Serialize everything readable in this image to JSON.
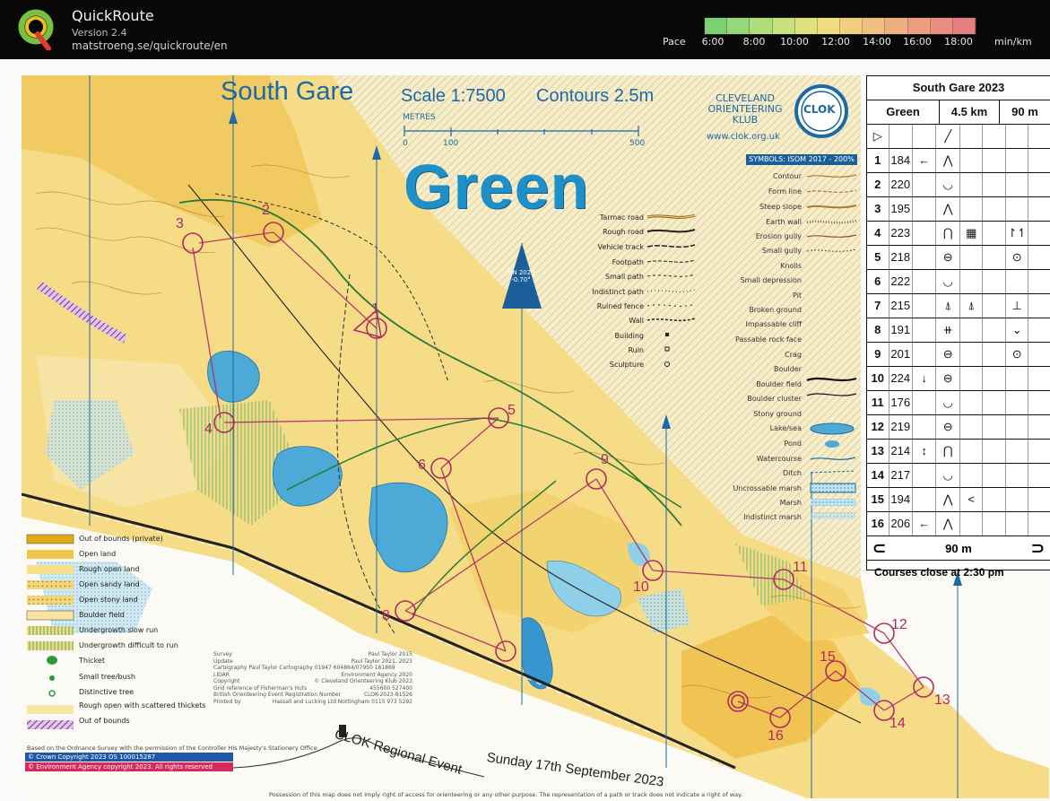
{
  "app": {
    "title": "QuickRoute",
    "version": "Version 2.4",
    "url": "matstroeng.se/quickroute/en"
  },
  "pace": {
    "label": "Pace",
    "ticks": [
      "6:00",
      "8:00",
      "10:00",
      "12:00",
      "14:00",
      "16:00",
      "18:00"
    ],
    "unit": "min/km",
    "colors": [
      "#7bd076",
      "#95d77a",
      "#b0dc7c",
      "#c8e07e",
      "#dfe27f",
      "#eddc80",
      "#f2cf80",
      "#f1bf80",
      "#efaf80",
      "#ec9e80",
      "#e98e80",
      "#e67f80"
    ]
  },
  "map": {
    "title": "South Gare",
    "scale": "Scale 1:7500",
    "contours": "Contours 2.5m",
    "scalebar_unit": "METRES",
    "scalebar_ticks": [
      "0",
      "100",
      "500"
    ],
    "course": "Green",
    "club_name": "CLEVELAND ORIENTEERING KLUB",
    "club_url": "www.clok.org.uk",
    "club_logo_text": "CLOK",
    "symbols_badge": "SYMBOLS: ISOM 2017 - 200%",
    "magnetic_north": "MN 2023 -0.70°",
    "event_title": "CLOK Regional Event",
    "event_date": "Sunday 17th September 2023",
    "controls": [
      "1",
      "2",
      "3",
      "4",
      "5",
      "6",
      "8",
      "9",
      "10",
      "11",
      "12",
      "13",
      "14",
      "15",
      "16"
    ]
  },
  "legend_right": [
    "Contour",
    "Form line",
    "Steep slope",
    "Earth wall",
    "Erosion gully",
    "Small gully",
    "Knolls",
    "Small depression",
    "Pit",
    "Broken ground",
    "Impassable cliff",
    "Passable rock face",
    "Crag",
    "Boulder",
    "Boulder field",
    "Boulder cluster",
    "Stony ground",
    "Lake/sea",
    "Pond",
    "Watercourse",
    "Ditch",
    "Uncrossable marsh",
    "Marsh",
    "Indistinct marsh"
  ],
  "legend_mid": [
    "Tarmac road",
    "Rough road",
    "Vehicle track",
    "Footpath",
    "Small path",
    "Indistinct path",
    "Ruined fence",
    "Wall",
    "Building",
    "Ruin",
    "Sculpture"
  ],
  "legend_left": [
    "Out of bounds (private)",
    "Open land",
    "Rough open land",
    "Open sandy land",
    "Open stony land",
    "Boulder field",
    "Undergrowth slow run",
    "Undergrowth difficult to run",
    "Thicket",
    "Small tree/bush",
    "Distinctive tree",
    "Rough open with scattered thickets",
    "Out of bounds"
  ],
  "credits": [
    [
      "Survey",
      "Paul Taylor 2015"
    ],
    [
      "Update",
      "Paul Taylor 2021, 2023"
    ],
    [
      "Cartography Paul Taylor Cartography 01947 604864/07950 181869",
      ""
    ],
    [
      "LIDAR",
      "Environment Agency 2020"
    ],
    [
      "Copyright",
      "© Cleveland Orienteering Klub 2023"
    ],
    [
      "Grid reference of Fisherman's Huts",
      "455600 527400"
    ],
    [
      "British Orienteering Event Registration Number",
      "CLOK-2023-81526"
    ],
    [
      "Printed by",
      "Hassall and Lucking Ltd Nottingham 0115 973 5292"
    ]
  ],
  "survey_note": "Based on the Ordnance Survey with the permission of the Controller His Majesty's Stationery Office",
  "copyright_os": "© Crown Copyright 2023 OS 100015287",
  "copyright_ea": "© Environment Agency copyright 2023. All rights reserved",
  "possession": "Possession of this map does not imply right of access for orienteering or any other purpose. The representation of a path or track does not indicate a right of way.",
  "description": {
    "event": "South Gare 2023",
    "course": "Green",
    "length": "4.5 km",
    "climb": "90 m",
    "rows": [
      {
        "n": "1",
        "code": "184",
        "d": "←",
        "c": "⋀",
        "f": "",
        "g": ""
      },
      {
        "n": "2",
        "code": "220",
        "d": "",
        "c": "◡",
        "f": "",
        "g": ""
      },
      {
        "n": "3",
        "code": "195",
        "d": "",
        "c": "⋀",
        "f": "",
        "g": ""
      },
      {
        "n": "4",
        "code": "223",
        "d": "",
        "c": "⋂",
        "f": "▦",
        "g": "↾↿"
      },
      {
        "n": "5",
        "code": "218",
        "d": "",
        "c": "⊖",
        "f": "",
        "g": "⊙"
      },
      {
        "n": "6",
        "code": "222",
        "d": "",
        "c": "◡",
        "f": "",
        "g": ""
      },
      {
        "n": "7",
        "code": "215",
        "d": "",
        "c": "⍋",
        "f": "⍋",
        "g": "⊥"
      },
      {
        "n": "8",
        "code": "191",
        "d": "",
        "c": "⧺",
        "f": "",
        "g": "⌄"
      },
      {
        "n": "9",
        "code": "201",
        "d": "",
        "c": "⊖",
        "f": "",
        "g": "⊙"
      },
      {
        "n": "10",
        "code": "224",
        "d": "↓",
        "c": "⊖",
        "f": "",
        "g": ""
      },
      {
        "n": "11",
        "code": "176",
        "d": "",
        "c": "◡",
        "f": "",
        "g": ""
      },
      {
        "n": "12",
        "code": "219",
        "d": "",
        "c": "⊖",
        "f": "",
        "g": ""
      },
      {
        "n": "13",
        "code": "214",
        "d": "↕",
        "c": "⋂",
        "f": "",
        "g": ""
      },
      {
        "n": "14",
        "code": "217",
        "d": "",
        "c": "◡",
        "f": "",
        "g": ""
      },
      {
        "n": "15",
        "code": "194",
        "d": "",
        "c": "⋀",
        "f": "<",
        "g": ""
      },
      {
        "n": "16",
        "code": "206",
        "d": "←",
        "c": "⋀",
        "f": "",
        "g": ""
      }
    ],
    "finish_distance": "90 m",
    "closing": "Courses close at 2:30 pm"
  }
}
